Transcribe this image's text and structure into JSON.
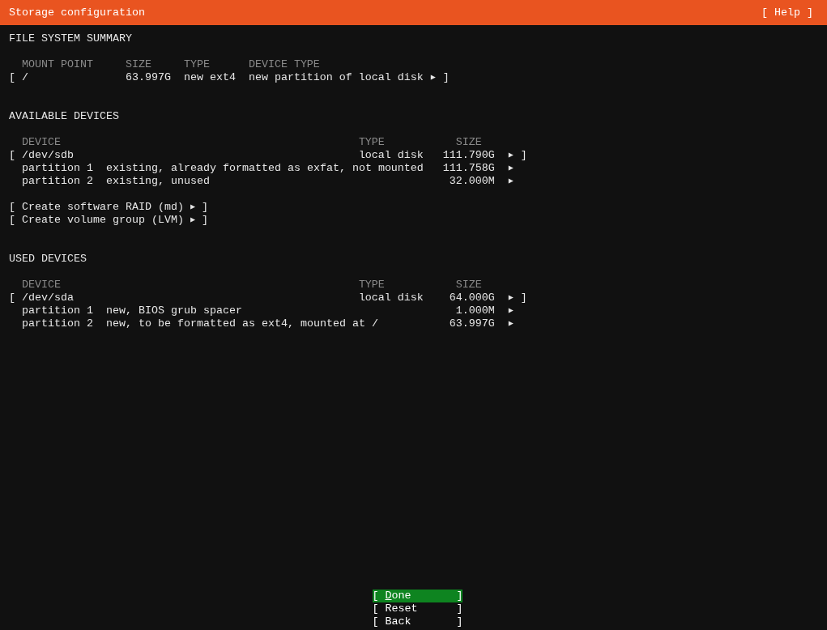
{
  "header": {
    "title": "Storage configuration",
    "help": "[ Help ]"
  },
  "summary": {
    "title": "FILE SYSTEM SUMMARY",
    "columns": [
      "MOUNT POINT",
      "SIZE",
      "TYPE",
      "DEVICE TYPE"
    ],
    "rows": [
      {
        "open": "[",
        "mount_point": "/",
        "size": "63.997G",
        "type": "new ext4",
        "device_type": "new partition of local disk",
        "arrow": "▶",
        "close": "]"
      }
    ]
  },
  "available": {
    "title": "AVAILABLE DEVICES",
    "columns": [
      "DEVICE",
      "TYPE",
      "SIZE"
    ],
    "devices": [
      {
        "open": "[",
        "name": "/dev/sdb",
        "type": "local disk",
        "size": "111.790G",
        "arrow": "▶",
        "close": "]",
        "partitions": [
          {
            "label": "partition 1",
            "description": "existing, already formatted as exfat, not mounted",
            "size": "111.758G",
            "arrow": "▶"
          },
          {
            "label": "partition 2",
            "description": "existing, unused",
            "size": "32.000M",
            "arrow": "▶"
          }
        ]
      }
    ],
    "actions": [
      {
        "open": "[",
        "label": "Create software RAID (md)",
        "arrow": "▶",
        "close": "]"
      },
      {
        "open": "[",
        "label": "Create volume group (LVM)",
        "arrow": "▶",
        "close": "]"
      }
    ]
  },
  "used": {
    "title": "USED DEVICES",
    "columns": [
      "DEVICE",
      "TYPE",
      "SIZE"
    ],
    "devices": [
      {
        "open": "[",
        "name": "/dev/sda",
        "type": "local disk",
        "size": "64.000G",
        "arrow": "▶",
        "close": "]",
        "partitions": [
          {
            "label": "partition 1",
            "description": "new, BIOS grub spacer",
            "size": "1.000M",
            "arrow": "▶"
          },
          {
            "label": "partition 2",
            "description": "new, to be formatted as ext4, mounted at /",
            "size": "63.997G",
            "arrow": "▶"
          }
        ]
      }
    ]
  },
  "buttons": [
    {
      "open": "[",
      "label": "Done",
      "close": "]",
      "selected": true
    },
    {
      "open": "[",
      "label": "Reset",
      "close": "]",
      "selected": false
    },
    {
      "open": "[",
      "label": "Back",
      "close": "]",
      "selected": false
    }
  ]
}
